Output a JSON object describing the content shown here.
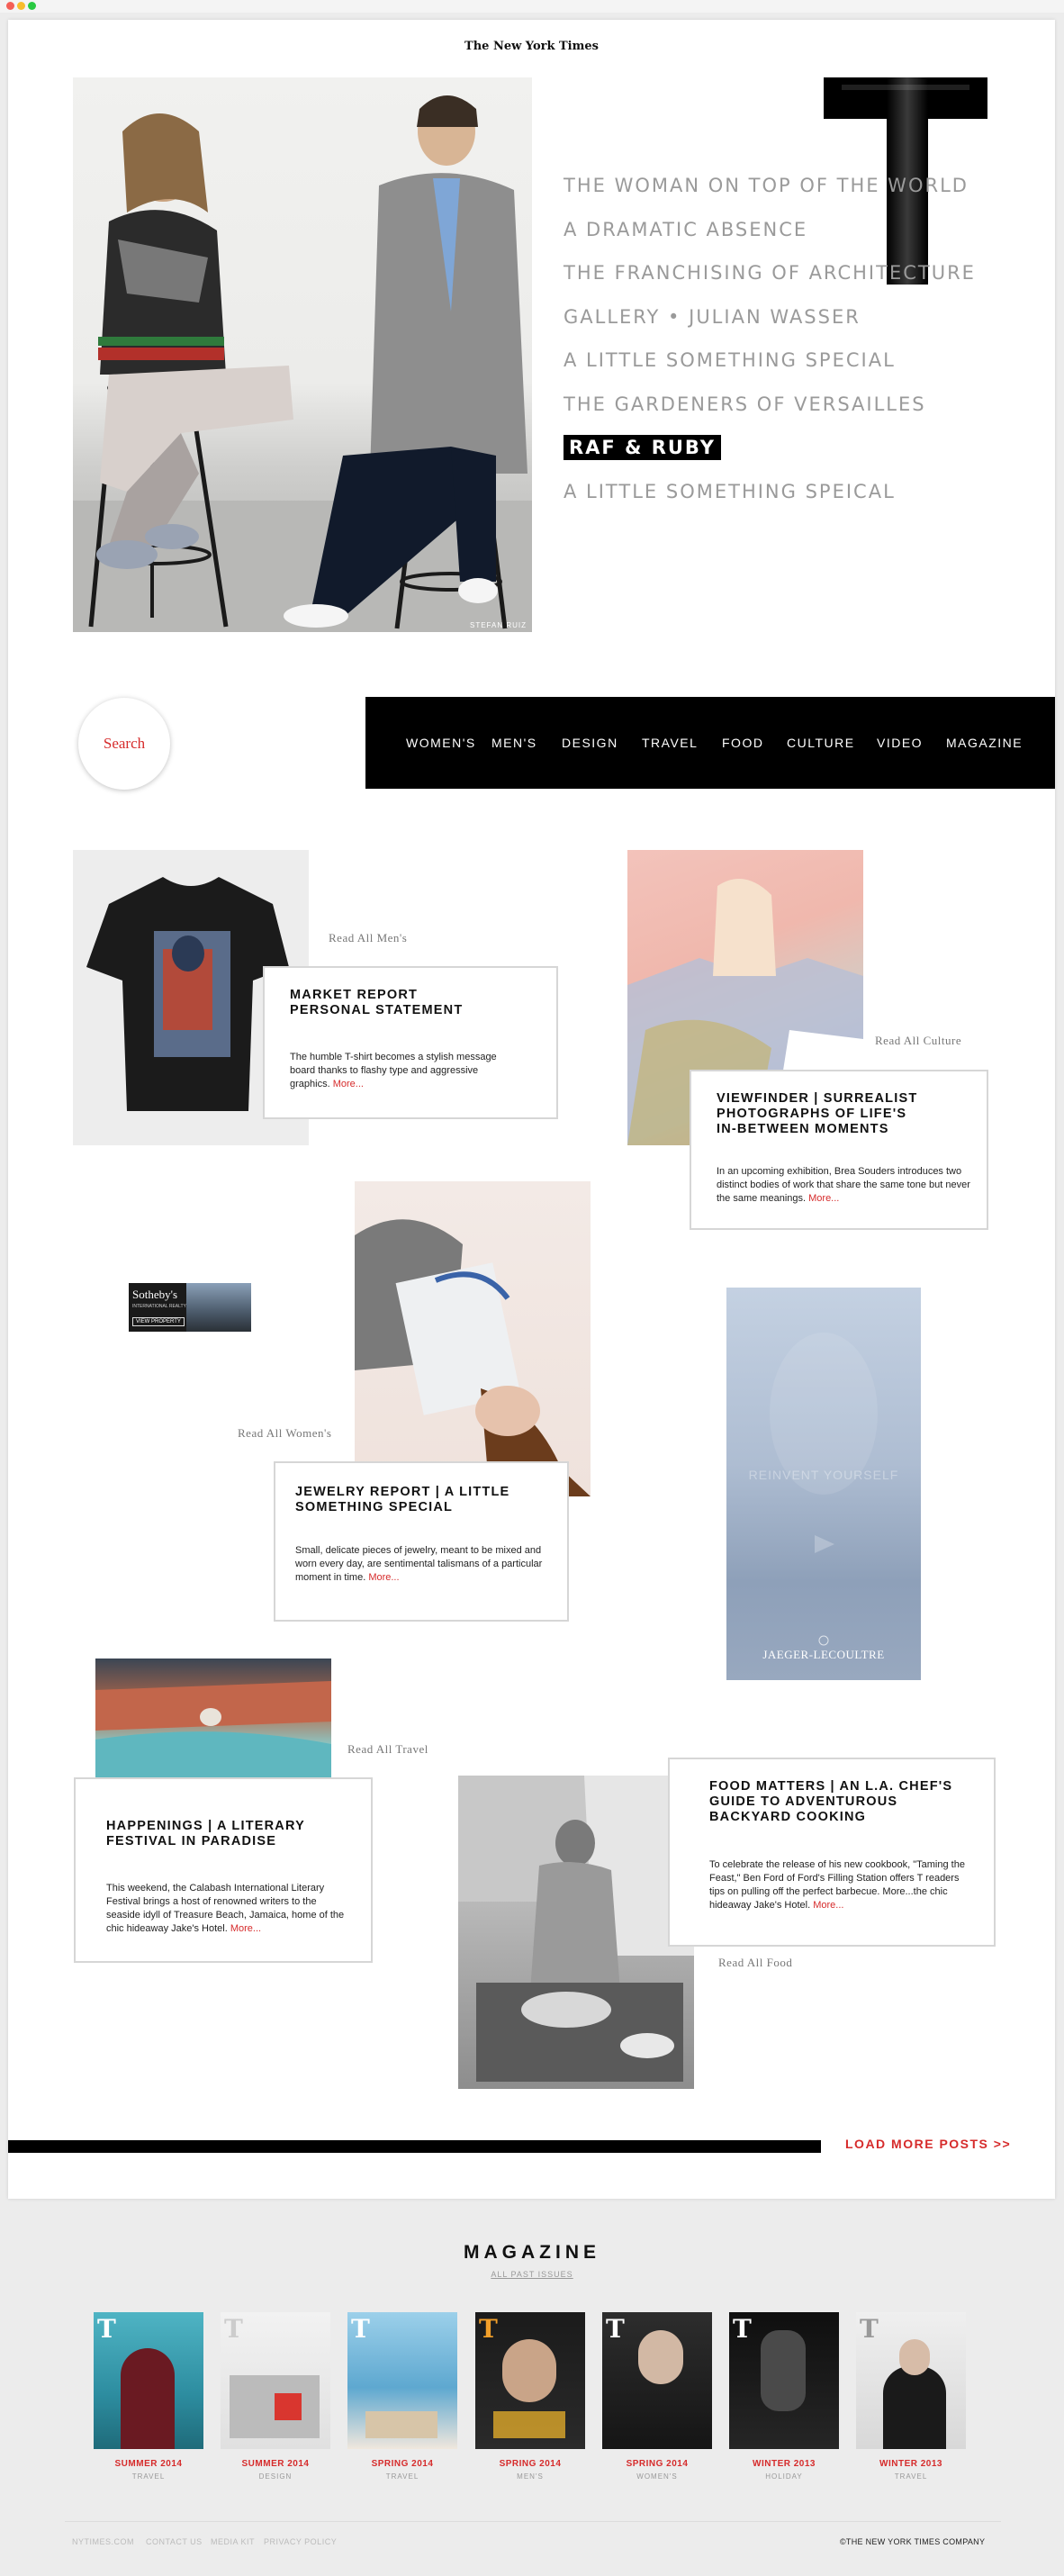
{
  "masthead": "The New York Times",
  "hero": {
    "credit": "STEFAN RUIZ",
    "items": [
      "THE WOMAN ON TOP OF THE WORLD",
      "A DRAMATIC ABSENCE",
      "THE FRANCHISING OF ARCHITECTURE",
      "GALLERY • JULIAN WASSER",
      "A LITTLE SOMETHING SPECIAL",
      "THE GARDENERS OF VERSAILLES",
      "RAF & RUBY",
      "A LITTLE SOMETHING SPEICAL"
    ]
  },
  "search": {
    "label": "Search"
  },
  "nav": [
    "WOMEN'S",
    "MEN'S",
    "DESIGN",
    "TRAVEL",
    "FOOD",
    "CULTURE",
    "VIDEO",
    "MAGAZINE"
  ],
  "cards": {
    "mens": {
      "read_all": "Read All Men's",
      "title": "MARKET REPORT\nPERSONAL STATEMENT",
      "body": "The humble T-shirt becomes a stylish message board thanks to flashy type and aggressive graphics.",
      "more": "More..."
    },
    "culture": {
      "read_all": "Read All Culture",
      "title": "VIEWFINDER | SURREALIST\nPHOTOGRAPHS OF LIFE'S\nIN-BETWEEN MOMENTS",
      "body": "In an upcoming exhibition, Brea Souders introduces two distinct bodies of work that share the same tone but never the same meanings.",
      "more": "More..."
    },
    "womens": {
      "read_all": "Read All Women's",
      "title": "JEWELRY REPORT | A LITTLE\nSOMETHING SPECIAL",
      "body": "Small, delicate pieces of jewelry, meant to be mixed and worn every day, are sentimental talismans of a particular moment in time.",
      "more": "More..."
    },
    "travel": {
      "read_all": "Read All Travel",
      "title": "HAPPENINGS | A LITERARY\nFESTIVAL IN PARADISE",
      "body": "This weekend, the Calabash International Literary Festival brings a host of renowned writers to the seaside idyll of Treasure Beach, Jamaica, home of the chic hideaway Jake's Hotel.",
      "more": "More..."
    },
    "food": {
      "read_all": "Read All Food",
      "title": "FOOD MATTERS | AN L.A. CHEF'S\nGUIDE TO ADVENTUROUS\nBACKYARD COOKING",
      "body": "To celebrate the release of his new cookbook, \"Taming the Feast,\" Ben Ford of Ford's Filling Station offers T readers tips on pulling off the perfect barbecue. More...the chic hideaway Jake's Hotel.",
      "more": "More..."
    }
  },
  "ads": {
    "sothebys_name": "Sotheby's",
    "sothebys_sub": "INTERNATIONAL REALTY",
    "sothebys_cta": "VIEW PROPERTY",
    "jlc_headline": "REINVENT YOURSELF",
    "jlc_brand": "JAEGER-LECOULTRE"
  },
  "load_more": "LOAD MORE POSTS >>",
  "magazine": {
    "title": "MAGAZINE",
    "subtitle": "ALL PAST ISSUES",
    "issues": [
      {
        "season": "SUMMER 2014",
        "category": "TRAVEL"
      },
      {
        "season": "SUMMER 2014",
        "category": "DESIGN"
      },
      {
        "season": "SPRING 2014",
        "category": "TRAVEL"
      },
      {
        "season": "SPRING 2014",
        "category": "MEN'S"
      },
      {
        "season": "SPRING 2014",
        "category": "WOMEN'S"
      },
      {
        "season": "WINTER 2013",
        "category": "HOLIDAY"
      },
      {
        "season": "WINTER 2013",
        "category": "TRAVEL"
      }
    ]
  },
  "footer": {
    "links": [
      "NYTIMES.COM",
      "CONTACT US",
      "MEDIA KIT",
      "PRIVACY POLICY"
    ],
    "copyright": "©THE NEW YORK TIMES COMPANY"
  }
}
